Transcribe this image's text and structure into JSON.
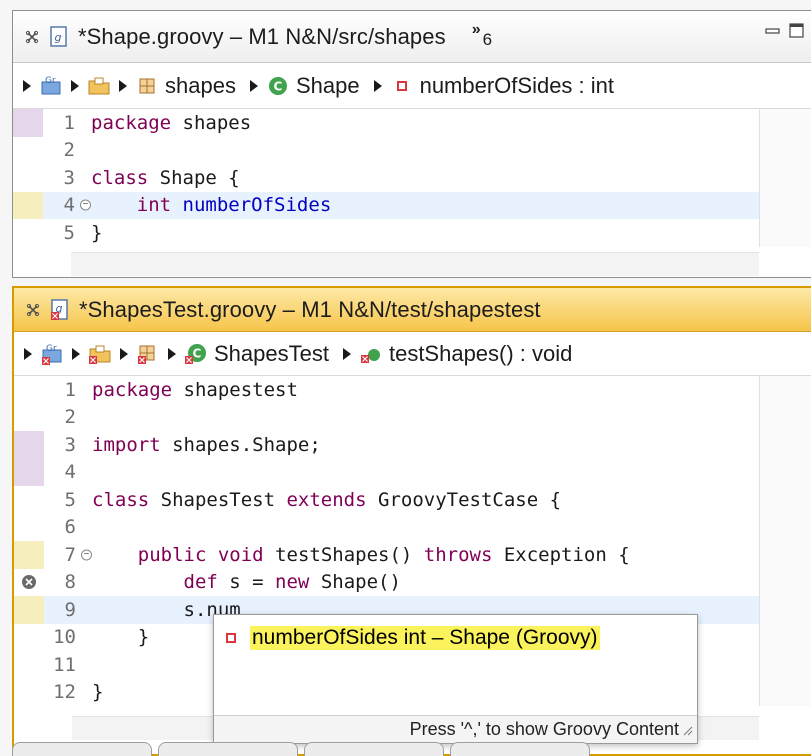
{
  "top_editor": {
    "tab_title": "*Shape.groovy – M1 N&N/src/shapes",
    "overflow_count": "6",
    "breadcrumb": {
      "package": "shapes",
      "class": "Shape",
      "field": "numberOfSides : int"
    },
    "lines": [
      {
        "num": "1",
        "parts": [
          {
            "t": "package",
            "c": "kw"
          },
          {
            "t": " shapes",
            "c": ""
          }
        ]
      },
      {
        "num": "2",
        "parts": []
      },
      {
        "num": "3",
        "parts": [
          {
            "t": "class",
            "c": "kw"
          },
          {
            "t": " Shape {",
            "c": ""
          }
        ]
      },
      {
        "num": "4",
        "parts": [
          {
            "t": "    ",
            "c": ""
          },
          {
            "t": "int",
            "c": "kw"
          },
          {
            "t": " ",
            "c": ""
          },
          {
            "t": "numberOfSides",
            "c": "fld"
          }
        ]
      },
      {
        "num": "5",
        "parts": [
          {
            "t": "}",
            "c": ""
          }
        ]
      }
    ]
  },
  "bottom_editor": {
    "tab_title": "*ShapesTest.groovy – M1 N&N/test/shapestest",
    "breadcrumb": {
      "class": "ShapesTest",
      "method": "testShapes() : void"
    },
    "lines": [
      {
        "num": "1",
        "parts": [
          {
            "t": "package",
            "c": "kw"
          },
          {
            "t": " shapestest",
            "c": ""
          }
        ]
      },
      {
        "num": "2",
        "parts": []
      },
      {
        "num": "3",
        "parts": [
          {
            "t": "import",
            "c": "kw"
          },
          {
            "t": " shapes.Shape;",
            "c": ""
          }
        ]
      },
      {
        "num": "4",
        "parts": []
      },
      {
        "num": "5",
        "parts": [
          {
            "t": "class",
            "c": "kw"
          },
          {
            "t": " ShapesTest ",
            "c": ""
          },
          {
            "t": "extends",
            "c": "kw"
          },
          {
            "t": " GroovyTestCase {",
            "c": ""
          }
        ]
      },
      {
        "num": "6",
        "parts": []
      },
      {
        "num": "7",
        "parts": [
          {
            "t": "    ",
            "c": ""
          },
          {
            "t": "public",
            "c": "kw"
          },
          {
            "t": " ",
            "c": ""
          },
          {
            "t": "void",
            "c": "kw"
          },
          {
            "t": " testShapes() ",
            "c": ""
          },
          {
            "t": "throws",
            "c": "kw"
          },
          {
            "t": " Exception {",
            "c": ""
          }
        ]
      },
      {
        "num": "8",
        "parts": [
          {
            "t": "        ",
            "c": ""
          },
          {
            "t": "def",
            "c": "kw"
          },
          {
            "t": " s = ",
            "c": ""
          },
          {
            "t": "new",
            "c": "kw"
          },
          {
            "t": " Shape()",
            "c": ""
          }
        ]
      },
      {
        "num": "9",
        "parts": [
          {
            "t": "        s.num",
            "c": ""
          }
        ]
      },
      {
        "num": "10",
        "parts": [
          {
            "t": "    }",
            "c": ""
          }
        ]
      },
      {
        "num": "11",
        "parts": []
      },
      {
        "num": "12",
        "parts": [
          {
            "t": "}",
            "c": ""
          }
        ]
      }
    ]
  },
  "completion": {
    "item": "numberOfSides int – Shape (Groovy)",
    "footer": "Press '^,' to show Groovy Content"
  },
  "colors": {
    "keyword": "#7f0055",
    "field": "#0000c0",
    "current_line": "#e8f2fe",
    "active_tab": "#f6c44a",
    "completion_highlight": "#fbf35b"
  }
}
